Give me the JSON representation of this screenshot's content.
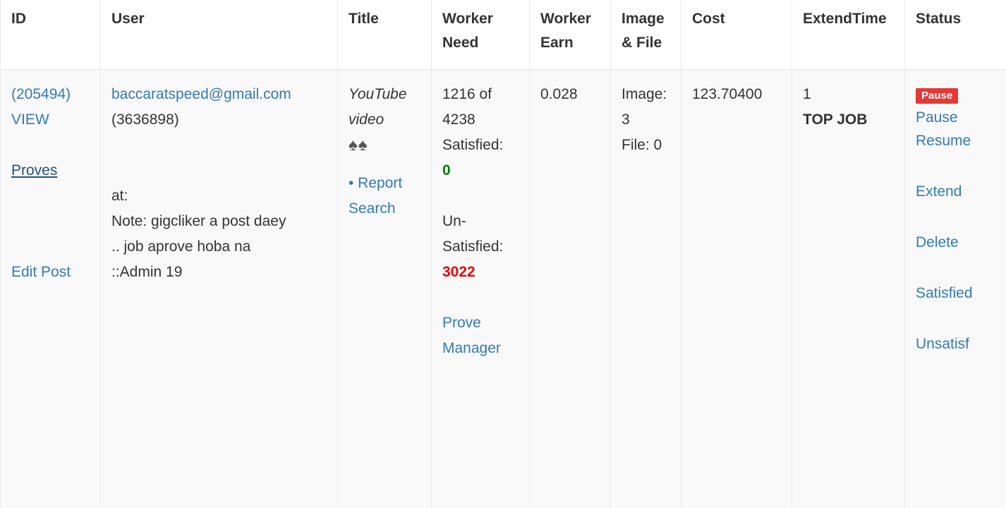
{
  "headers": {
    "id": "ID",
    "user": "User",
    "title": "Title",
    "worker_need": [
      "Worker",
      "Need"
    ],
    "worker_earn": [
      "Worker",
      "Earn"
    ],
    "image_file": [
      "Image",
      "& File"
    ],
    "cost": "Cost",
    "extend_time": "ExtendTime",
    "status": "Status"
  },
  "row": {
    "id_link": "(205494)",
    "view_link": "VIEW",
    "proves_link": "Proves",
    "edit_post_link": "Edit Post",
    "user_email": "baccaratspeed@gmail.com",
    "user_id": "(3636898)",
    "at_label": "at:",
    "note": [
      "Note: gigcliker a post daey",
      ".. job aprove hoba na",
      "::Admin 19"
    ],
    "title_text": [
      "YouTube",
      "video"
    ],
    "title_icons": "♠♠",
    "report_link": "• Report",
    "search_link": "Search",
    "need_progress": [
      "1216 of",
      "4238"
    ],
    "satisfied_label": "Satisfied:",
    "satisfied_count": "0",
    "unsatisfied_label": [
      "Un-",
      "Satisfied:"
    ],
    "unsatisfied_count": "3022",
    "prove_manager_link": [
      "Prove",
      "Manager"
    ],
    "worker_earn": "0.028",
    "image_label": [
      "Image:",
      "3"
    ],
    "file_label": "File: 0",
    "cost": "123.70400",
    "extend_count": "1",
    "top_job": "TOP JOB",
    "status_badge": "Pause",
    "status_links": [
      "Pause",
      "Resume",
      "Extend",
      "Delete",
      "Satisfied",
      "Unsatisf"
    ]
  },
  "colors": {
    "link": "#337ab7",
    "satisfied": "#008000",
    "unsatisfied": "#ee0000",
    "badge": "#e53935"
  }
}
